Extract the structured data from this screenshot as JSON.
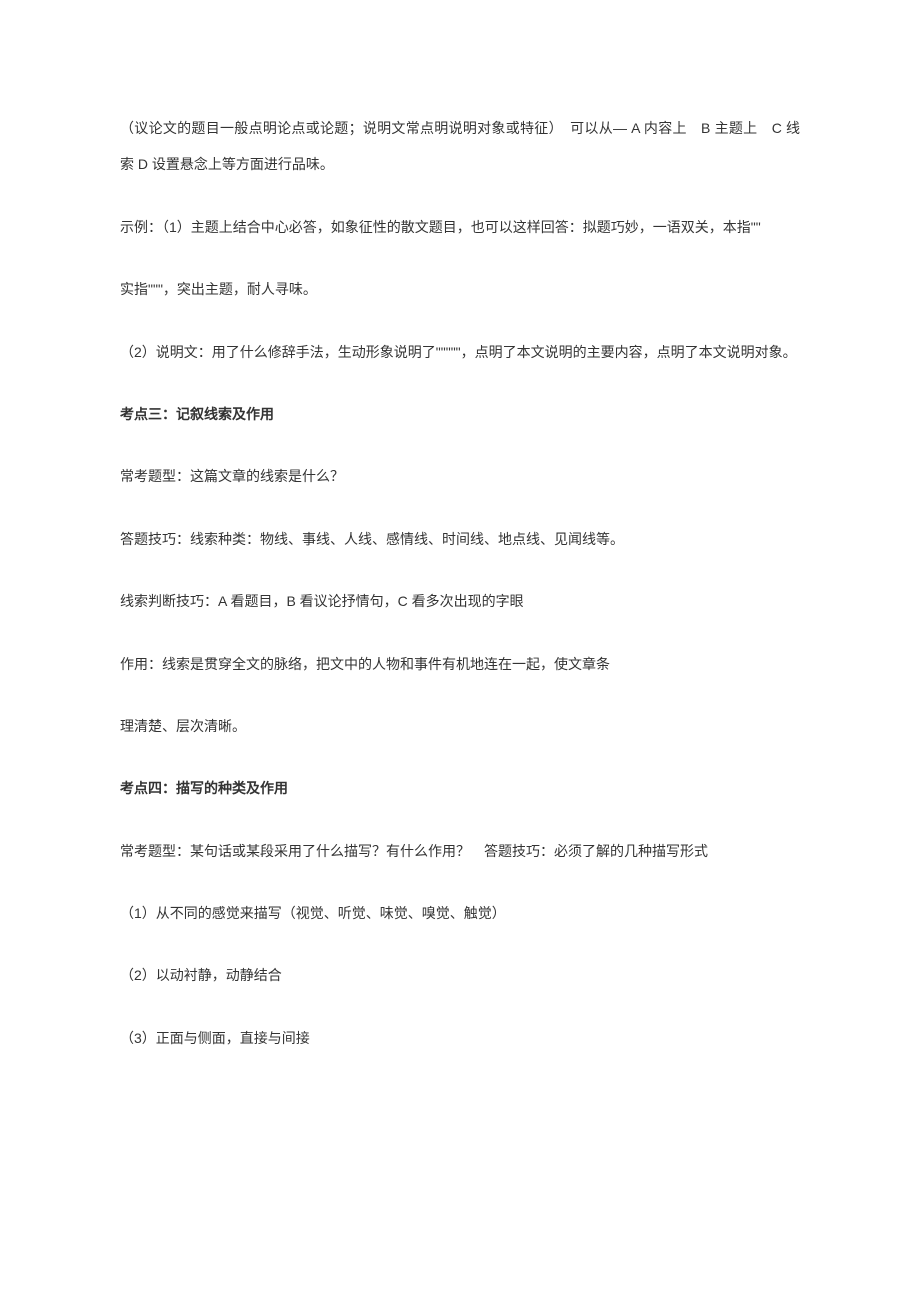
{
  "paragraphs": [
    {
      "text": "（议论文的题目一般点明论点或论题；说明文常点明说明对象或特征）　可以从— A 内容上　B 主题上　C 线索 D 设置悬念上等方面进行品味。",
      "bold": false
    },
    {
      "text": "示例：（1）主题上结合中心必答，如象征性的散文题目，也可以这样回答：拟题巧妙，一语双关，本指\"\"",
      "bold": false
    },
    {
      "text": "实指\"\"\"，突出主题，耐人寻味。",
      "bold": false
    },
    {
      "text": "（2）说明文：用了什么修辞手法，生动形象说明了\"\"\"\"\"，点明了本文说明的主要内容，点明了本文说明对象。",
      "bold": false
    },
    {
      "text": "考点三：记叙线索及作用",
      "bold": true
    },
    {
      "text": "常考题型：这篇文章的线索是什么？",
      "bold": false
    },
    {
      "text": "答题技巧：线索种类：物线、事线、人线、感情线、时间线、地点线、见闻线等。",
      "bold": false
    },
    {
      "text": "线索判断技巧：A 看题目，B 看议论抒情句，C 看多次出现的字眼",
      "bold": false
    },
    {
      "text": "作用：线索是贯穿全文的脉络，把文中的人物和事件有机地连在一起，使文章条",
      "bold": false
    },
    {
      "text": "理清楚、层次清晰。",
      "bold": false
    },
    {
      "text": "考点四：描写的种类及作用",
      "bold": true
    },
    {
      "text": "常考题型：某句话或某段采用了什么描写？有什么作用？　答题技巧：必须了解的几种描写形式",
      "bold": false
    },
    {
      "text": "（1）从不同的感觉来描写（视觉、听觉、味觉、嗅觉、触觉）",
      "bold": false
    },
    {
      "text": "（2）以动衬静，动静结合",
      "bold": false
    },
    {
      "text": "（3）正面与侧面，直接与间接",
      "bold": false
    }
  ]
}
